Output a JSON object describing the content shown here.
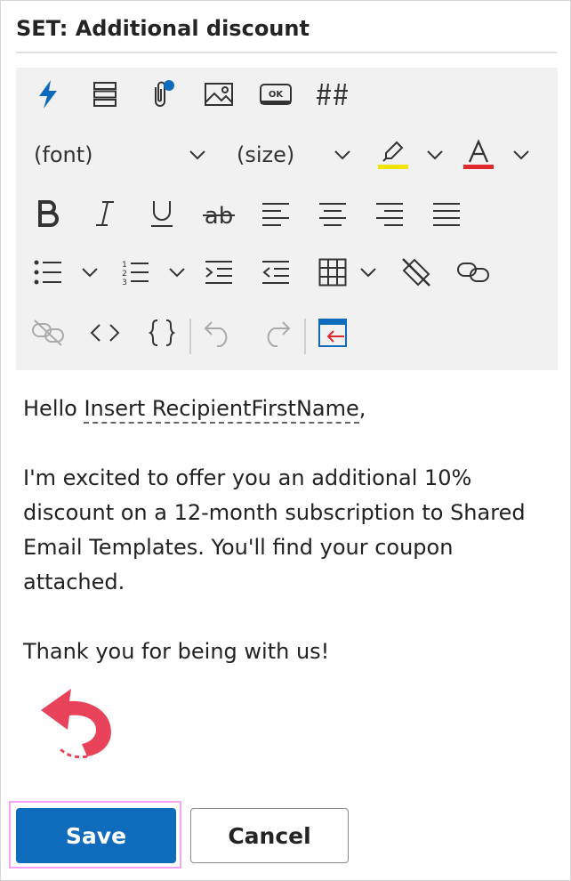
{
  "title": "SET: Additional discount",
  "toolbar": {
    "font_label": "(font)",
    "size_label": "(size)",
    "highlight_color": "#f5e400",
    "font_color": "#e0282e",
    "accent_color": "#0f6cbd",
    "icons_row1": [
      "lightning-icon",
      "fields-list-icon",
      "attachment-icon",
      "image-icon",
      "ok-button-icon",
      "hashtag-icon"
    ],
    "icons_row3": [
      "bold-icon",
      "italic-icon",
      "underline-icon",
      "strikethrough-icon",
      "align-left-icon",
      "align-center-icon",
      "align-right-icon",
      "justify-icon"
    ],
    "icons_row4": [
      "bullet-list-icon",
      "numbered-list-icon",
      "indent-icon",
      "outdent-icon",
      "table-icon",
      "clear-format-icon",
      "link-icon"
    ],
    "icons_row5": [
      "unlink-icon",
      "code-icon",
      "braces-icon",
      "undo-icon",
      "redo-icon",
      "insert-icon"
    ]
  },
  "content": {
    "greeting": "Hello ",
    "variable": "Insert RecipientFirstName",
    "greeting_end": ",",
    "paragraph": "I'm excited to offer you an additional 10% discount on a 12-month subscription to Shared Email Templates. You'll find your coupon attached.",
    "closing": "Thank you for being with us!"
  },
  "buttons": {
    "save": "Save",
    "cancel": "Cancel"
  }
}
